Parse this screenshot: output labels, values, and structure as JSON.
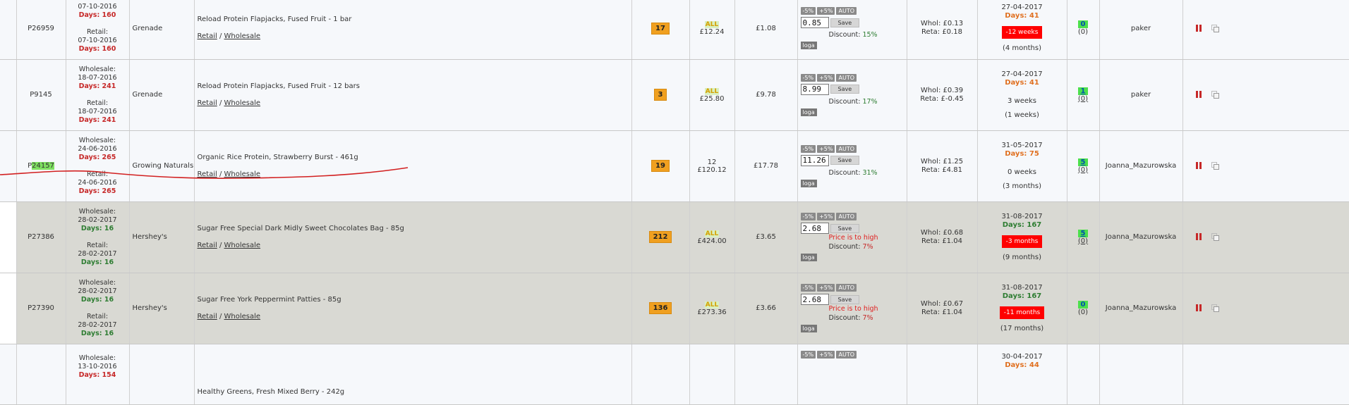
{
  "buttons": {
    "minus5": "-5%",
    "plus5": "+5%",
    "auto": "AUTO",
    "save": "Save",
    "loga": "loga"
  },
  "labels": {
    "wholesale": "Wholesale:",
    "retail": "Retail:",
    "retail_link": "Retail",
    "wholesale_link": "Wholesale",
    "discount": "Discount:",
    "whol": "Whol:",
    "reta": "Reta:",
    "all": "ALL",
    "price_high": "Price is to high",
    "slash": "/"
  },
  "rows": [
    {
      "id": "P26959",
      "wholesale_date": "07-10-2016",
      "wholesale_days": "Days: 160",
      "retail_date": "07-10-2016",
      "retail_days": "Days: 160",
      "brand": "Grenade",
      "product": "Reload Protein Flapjacks, Fused Fruit - 1 bar",
      "stock": "17",
      "all_top": "ALL",
      "all_value": "£12.24",
      "cost": "£1.08",
      "sell_price": "0.85",
      "warning": "",
      "discount": "15%",
      "whol_margin": "£0.13",
      "reta_margin": "£0.18",
      "expiry_date": "27-04-2017",
      "expiry_days": "Days: 41",
      "expiry_note": "-12 weeks",
      "expiry_sub": "(4 months)",
      "orders": "0",
      "orders_sub": "(0)",
      "user": "paker"
    },
    {
      "id": "P9145",
      "wholesale_date": "18-07-2016",
      "wholesale_days": "Days: 241",
      "retail_date": "18-07-2016",
      "retail_days": "Days: 241",
      "brand": "Grenade",
      "product": "Reload Protein Flapjacks, Fused Fruit - 12 bars",
      "stock": "3",
      "all_top": "ALL",
      "all_value": "£25.80",
      "cost": "£9.78",
      "sell_price": "8.99",
      "warning": "",
      "discount": "17%",
      "whol_margin": "£0.39",
      "reta_margin": "£-0.45",
      "expiry_date": "27-04-2017",
      "expiry_days": "Days: 41",
      "expiry_note": "3 weeks",
      "expiry_sub": "(1 weeks)",
      "orders": "1",
      "orders_sub": "(0)",
      "user": "paker"
    },
    {
      "id_prefix": "P",
      "id_highlight": "24157",
      "wholesale_date": "24-06-2016",
      "wholesale_days": "Days: 265",
      "retail_date": "24-06-2016",
      "retail_days": "Days: 265",
      "brand": "Growing Naturals",
      "product": "Organic Rice Protein, Strawberry Burst - 461g",
      "stock": "19",
      "all_top": "12",
      "all_value": "£120.12",
      "cost": "£17.78",
      "sell_price": "11.26",
      "warning": "",
      "discount": "31%",
      "whol_margin": "£1.25",
      "reta_margin": "£4.81",
      "expiry_date": "31-05-2017",
      "expiry_days": "Days: 75",
      "expiry_note": "0 weeks",
      "expiry_sub": "(3 months)",
      "orders": "5",
      "orders_sub": "(0)",
      "user": "Joanna_Mazurowska"
    },
    {
      "id": "P27386",
      "wholesale_date": "28-02-2017",
      "wholesale_days": "Days: 16",
      "retail_date": "28-02-2017",
      "retail_days": "Days: 16",
      "brand": "Hershey's",
      "product": "Sugar Free Special Dark Midly Sweet Chocolates Bag - 85g",
      "stock": "212",
      "all_top": "ALL",
      "all_value": "£424.00",
      "cost": "£3.65",
      "sell_price": "2.68",
      "warning": "Price is to high",
      "discount": "7%",
      "whol_margin": "£0.68",
      "reta_margin": "£1.04",
      "expiry_date": "31-08-2017",
      "expiry_days": "Days: 167",
      "expiry_note": "-3 months",
      "expiry_sub": "(9 months)",
      "orders": "5",
      "orders_sub": "(0)",
      "user": "Joanna_Mazurowska"
    },
    {
      "id": "P27390",
      "wholesale_date": "28-02-2017",
      "wholesale_days": "Days: 16",
      "retail_date": "28-02-2017",
      "retail_days": "Days: 16",
      "brand": "Hershey's",
      "product": "Sugar Free York Peppermint Patties - 85g",
      "stock": "136",
      "all_top": "ALL",
      "all_value": "£273.36",
      "cost": "£3.66",
      "sell_price": "2.68",
      "warning": "Price is to high",
      "discount": "7%",
      "whol_margin": "£0.67",
      "reta_margin": "£1.04",
      "expiry_date": "31-08-2017",
      "expiry_days": "Days: 167",
      "expiry_note": "-11 months",
      "expiry_sub": "(17 months)",
      "orders": "0",
      "orders_sub": "(0)",
      "user": "Joanna_Mazurowska"
    },
    {
      "wholesale_date": "13-10-2016",
      "wholesale_days": "Days: 154",
      "product": "Healthy Greens, Fresh Mixed Berry - 242g",
      "expiry_date": "30-04-2017",
      "expiry_days": "Days: 44"
    }
  ],
  "colors": {
    "accent_stock": "#f0a020",
    "expiry_alert": "#ff0000",
    "orders_badge": "#4ce04c",
    "annotation": "#d22020"
  }
}
